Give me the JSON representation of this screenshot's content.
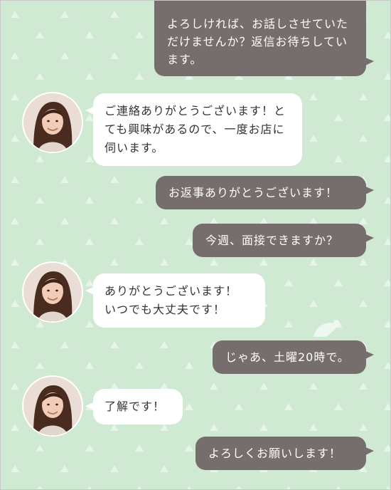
{
  "colors": {
    "background": "#cfe9d2",
    "outgoing_bubble": "#766e6c",
    "incoming_bubble": "#ffffff",
    "outgoing_text": "#ffffff",
    "incoming_text": "#333333"
  },
  "messages": [
    {
      "side": "outgoing",
      "text": "よろしければ、お話しさせていただけませんか？返信お待ちしています。"
    },
    {
      "side": "incoming",
      "avatar": "woman-avatar",
      "text": "ご連絡ありがとうございます！とても興味があるので、一度お店に伺います。"
    },
    {
      "side": "outgoing",
      "text": "お返事ありがとうございます！"
    },
    {
      "side": "outgoing",
      "text": "今週、面接できますか？"
    },
    {
      "side": "incoming",
      "avatar": "woman-avatar",
      "text": "ありがとうございます！\nいつでも大丈夫です！"
    },
    {
      "side": "outgoing",
      "text": "じゃあ、土曜20時で。"
    },
    {
      "side": "incoming",
      "avatar": "woman-avatar",
      "text": "了解です！"
    },
    {
      "side": "outgoing",
      "text": "よろしくお願いします！"
    }
  ]
}
